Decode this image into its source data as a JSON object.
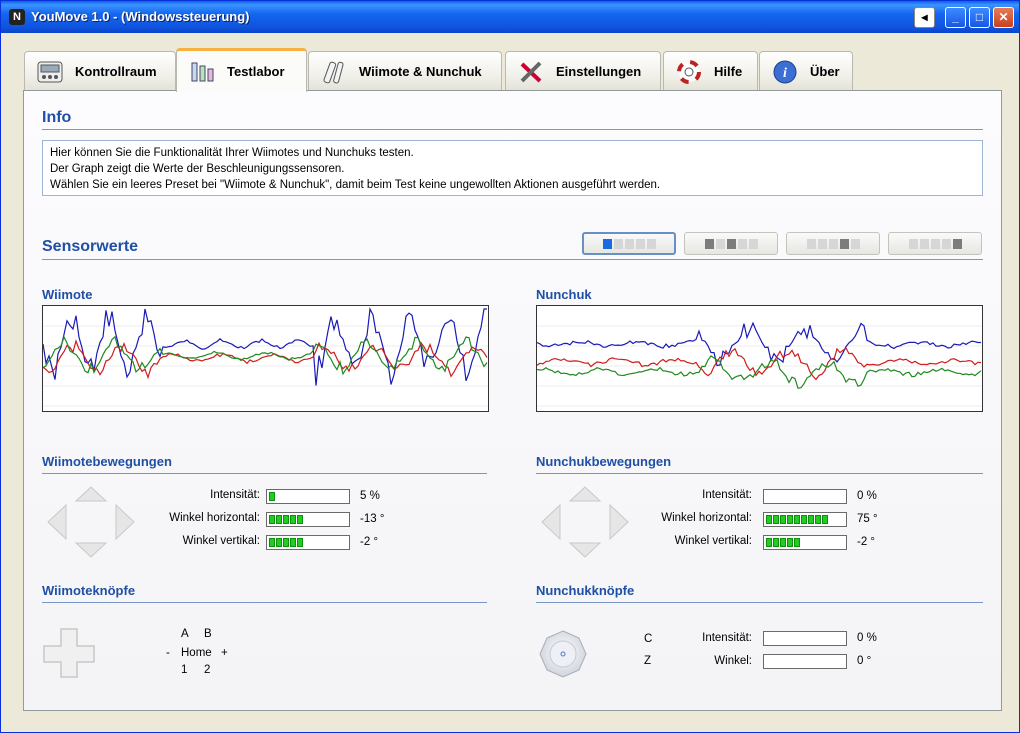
{
  "window": {
    "title": "YouMove 1.0 - (Windowssteuerung)",
    "app_icon": "N",
    "controls": {
      "back": "◂",
      "minimize": "_",
      "maximize": "□",
      "close": "✕"
    }
  },
  "tabs": [
    {
      "label": "Kontrollraum",
      "icon": "control-panel-icon"
    },
    {
      "label": "Testlabor",
      "icon": "lab-flask-icon",
      "active": true
    },
    {
      "label": "Wiimote & Nunchuk",
      "icon": "wiimote-icon"
    },
    {
      "label": "Einstellungen",
      "icon": "tools-icon"
    },
    {
      "label": "Hilfe",
      "icon": "lifebuoy-icon"
    },
    {
      "label": "Über",
      "icon": "info-icon"
    }
  ],
  "info": {
    "title": "Info",
    "lines": [
      "Hier können Sie die Funktionalität Ihrer Wiimotes und Nunchuks testen.",
      "Der Graph zeigt die Werte der Beschleunigungssensoren.",
      "Wählen Sie ein leeres Preset bei \"Wiimote & Nunchuk\", damit beim Test keine ungewollten Aktionen ausgeführt werden."
    ]
  },
  "sensors": {
    "title": "Sensorwerte",
    "wiimote_title": "Wiimote",
    "nunchuk_title": "Nunchuk",
    "series_colors": [
      "#1a1ab8",
      "#d11a1a",
      "#1e8a1e"
    ],
    "presets": [
      {
        "active": true
      },
      {
        "active": false
      },
      {
        "active": false
      },
      {
        "active": false
      }
    ]
  },
  "wiimote_movements": {
    "title": "Wiimotebewegungen",
    "rows": [
      {
        "label": "Intensität:",
        "segments": 1,
        "value": "5 %"
      },
      {
        "label": "Winkel horizontal:",
        "segments": 5,
        "value": "-13 °"
      },
      {
        "label": "Winkel vertikal:",
        "segments": 5,
        "value": "-2 °"
      }
    ]
  },
  "nunchuk_movements": {
    "title": "Nunchukbewegungen",
    "rows": [
      {
        "label": "Intensität:",
        "segments": 0,
        "value": "0 %"
      },
      {
        "label": "Winkel horizontal:",
        "segments": 9,
        "value": "75 °"
      },
      {
        "label": "Winkel vertikal:",
        "segments": 5,
        "value": "-2 °"
      }
    ]
  },
  "wiimote_buttons": {
    "title": "Wiimoteknöpfe",
    "a": "A",
    "b": "B",
    "minus": "-",
    "home": "Home",
    "plus": "+",
    "one": "1",
    "two": "2"
  },
  "nunchuk_buttons": {
    "title": "Nunchukknöpfe",
    "c": "C",
    "z": "Z",
    "rows": [
      {
        "label": "Intensität:",
        "segments": 0,
        "value": "0 %"
      },
      {
        "label": "Winkel:",
        "segments": 0,
        "value": "0 °"
      }
    ]
  }
}
